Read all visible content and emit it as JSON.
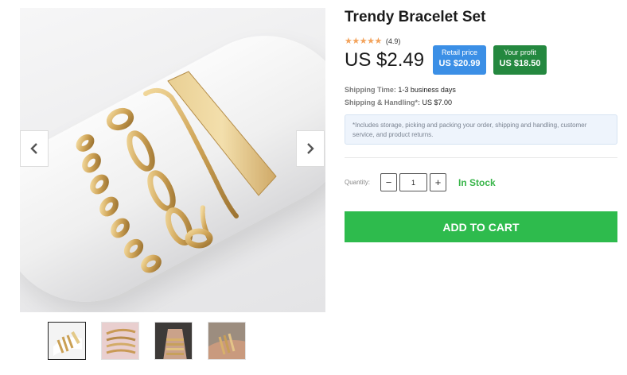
{
  "product": {
    "title": "Trendy Bracelet Set",
    "rating_value": "(4.9)",
    "rating_stars": 5,
    "price": "US $2.49"
  },
  "pricing": {
    "retail_label": "Retail price",
    "retail_value": "US $20.99",
    "profit_label": "Your profit",
    "profit_value": "US $18.50"
  },
  "shipping": {
    "time_label": "Shipping Time:",
    "time_value": "1-3 business days",
    "handling_label": "Shipping & Handling*:",
    "handling_value": "US $7.00",
    "note": "*Includes storage, picking and packing your order, shipping and handling, customer service, and product returns."
  },
  "purchase": {
    "quantity_label": "Quantity:",
    "quantity_value": "1",
    "minus": "−",
    "plus": "+",
    "stock_status": "In Stock",
    "add_to_cart": "ADD TO CART"
  },
  "gallery": {
    "prev_icon": "chevron-left-icon",
    "next_icon": "chevron-right-icon",
    "thumbnail_count": 4,
    "active_thumbnail": 1
  },
  "colors": {
    "retail_pill": "#3b8fe6",
    "profit_pill": "#24883f",
    "cart_button": "#2ebb4d",
    "in_stock": "#39b54a",
    "star": "#f3a35c"
  }
}
